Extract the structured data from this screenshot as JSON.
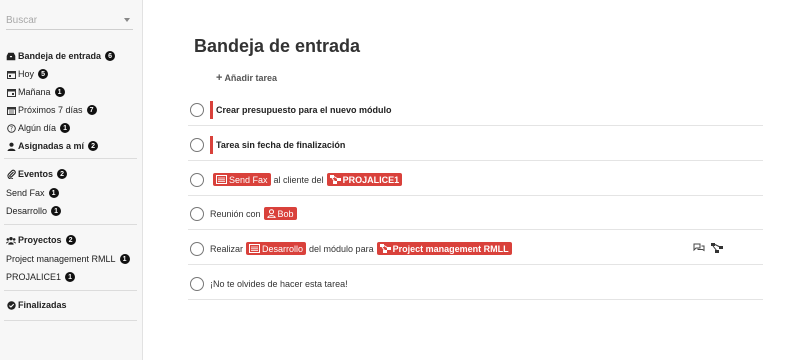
{
  "search": {
    "placeholder": "Buscar"
  },
  "sidebar": {
    "inbox": {
      "label": "Bandeja de entrada",
      "count": "6"
    },
    "today": {
      "label": "Hoy",
      "count": "5"
    },
    "tomorrow": {
      "label": "Mañana",
      "count": "1"
    },
    "next7": {
      "label": "Próximos 7 días",
      "count": "7"
    },
    "someday": {
      "label": "Algún día",
      "count": "1"
    },
    "assigned": {
      "label": "Asignadas a mí",
      "count": "2"
    },
    "events": {
      "label": "Eventos",
      "count": "2",
      "items": [
        {
          "label": "Send Fax",
          "count": "1"
        },
        {
          "label": "Desarrollo",
          "count": "1"
        }
      ]
    },
    "projects": {
      "label": "Proyectos",
      "count": "2",
      "items": [
        {
          "label": "Project management RMLL",
          "count": "1"
        },
        {
          "label": "PROJALICE1",
          "count": "1"
        }
      ]
    },
    "done": {
      "label": "Finalizadas"
    }
  },
  "main": {
    "title": "Bandeja de entrada",
    "add_task": "Añadir tarea",
    "tasks": [
      {
        "text": "Crear presupuesto para el nuevo módulo"
      },
      {
        "text": "Tarea sin fecha de finalización"
      },
      {
        "event": "Send Fax",
        "mid": "al cliente del",
        "project": "PROJALICE1"
      },
      {
        "pre": "Reunión con",
        "user": "Bob"
      },
      {
        "pre": "Realizar",
        "event": "Desarrollo",
        "mid": "del módulo para",
        "project": "Project management RMLL"
      },
      {
        "text": "¡No te olvides de hacer esta tarea!"
      }
    ]
  },
  "colors": {
    "accent": "#d9413b",
    "badge": "#111111",
    "sidebar_bg": "#f7f7f7"
  }
}
